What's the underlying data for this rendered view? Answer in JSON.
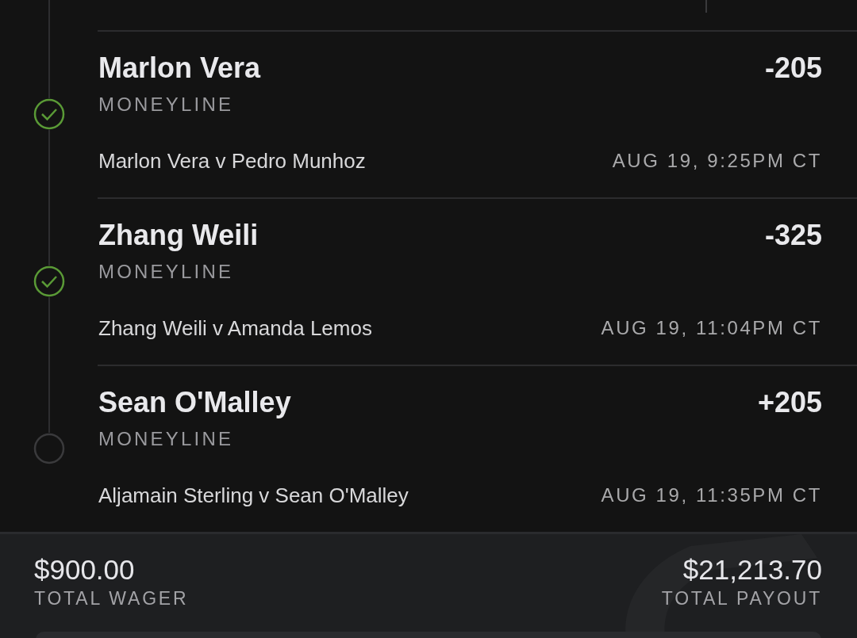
{
  "legs": [
    {
      "selection": "Marlon Vera",
      "odds": "-205",
      "market": "MONEYLINE",
      "matchup": "Marlon Vera v Pedro Munhoz",
      "time": "AUG 19, 9:25PM CT",
      "won": true
    },
    {
      "selection": "Zhang Weili",
      "odds": "-325",
      "market": "MONEYLINE",
      "matchup": "Zhang Weili v Amanda Lemos",
      "time": "AUG 19, 11:04PM CT",
      "won": true
    },
    {
      "selection": "Sean O'Malley",
      "odds": "+205",
      "market": "MONEYLINE",
      "matchup": "Aljamain Sterling v Sean O'Malley",
      "time": "AUG 19, 11:35PM CT",
      "won": false
    }
  ],
  "totals": {
    "wager": "$900.00",
    "wager_label": "TOTAL WAGER",
    "payout": "$21,213.70",
    "payout_label": "TOTAL PAYOUT"
  }
}
